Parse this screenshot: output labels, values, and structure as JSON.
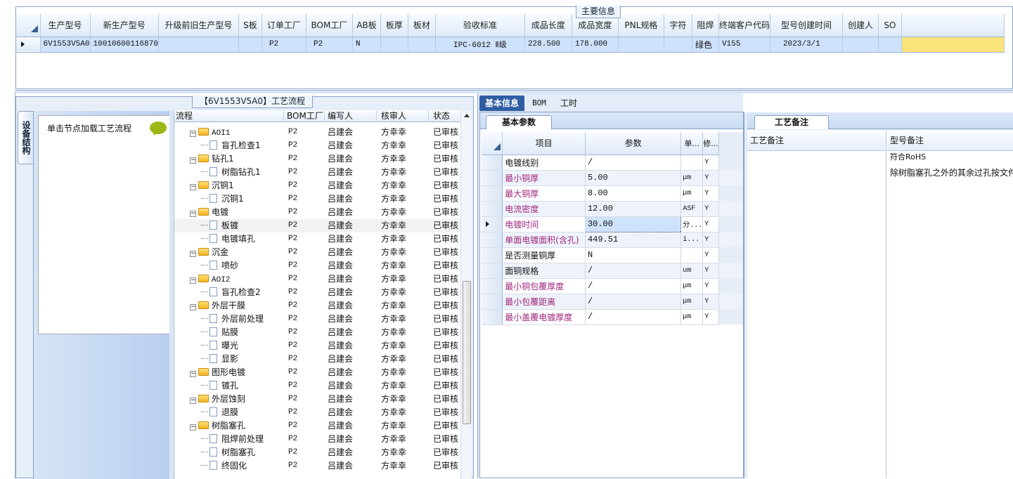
{
  "main": {
    "title": "主要信息",
    "columns": [
      "生产型号",
      "新生产型号",
      "升级前旧生产型号",
      "S板",
      "订单工厂",
      "BOM工厂",
      "AB板",
      "板厚",
      "板材",
      "验收标准",
      "成品长度",
      "成品宽度",
      "PNL规格",
      "字符",
      "阻焊",
      "终端客户代码",
      "型号创建时间",
      "创建人",
      "SO"
    ],
    "row": [
      "6V1553V5A0",
      "10010600116870",
      "",
      "",
      "P2",
      "P2",
      "N",
      "",
      "",
      "IPC-6012 Ⅱ级",
      "228.500",
      "178.000",
      "",
      "",
      "绿色",
      "V155",
      "2023/3/1",
      "",
      ""
    ]
  },
  "flow": {
    "title": "【6V1553V5A0】工艺流程",
    "vtab": "设备结构",
    "struct_hint": "单击节点加载工艺流程",
    "headers": [
      "流程",
      "BOM工厂",
      "编写人",
      "核审人",
      "状态"
    ],
    "rows": [
      {
        "name": "AOI1",
        "type": "folder",
        "bom": "P2",
        "writer": "吕建会",
        "reviewer": "方幸幸",
        "status": "已审核"
      },
      {
        "name": "盲孔检查1",
        "type": "doc",
        "bom": "P2",
        "writer": "吕建会",
        "reviewer": "方幸幸",
        "status": "已审核"
      },
      {
        "name": "钻孔1",
        "type": "folder",
        "bom": "P2",
        "writer": "吕建会",
        "reviewer": "方幸幸",
        "status": "已审核"
      },
      {
        "name": "树脂钻孔1",
        "type": "doc",
        "bom": "P2",
        "writer": "吕建会",
        "reviewer": "方幸幸",
        "status": "已审核"
      },
      {
        "name": "沉铜1",
        "type": "folder",
        "bom": "P2",
        "writer": "吕建会",
        "reviewer": "方幸幸",
        "status": "已审核"
      },
      {
        "name": "沉铜1",
        "type": "doc",
        "bom": "P2",
        "writer": "吕建会",
        "reviewer": "方幸幸",
        "status": "已审核"
      },
      {
        "name": "电镀",
        "type": "folder",
        "bom": "P2",
        "writer": "吕建会",
        "reviewer": "方幸幸",
        "status": "已审核"
      },
      {
        "name": "板镀",
        "type": "doc",
        "bom": "P2",
        "writer": "吕建会",
        "reviewer": "方幸幸",
        "status": "已审核",
        "selected": true
      },
      {
        "name": "电镀填孔",
        "type": "doc",
        "bom": "P2",
        "writer": "吕建会",
        "reviewer": "方幸幸",
        "status": "已审核"
      },
      {
        "name": "沉金",
        "type": "folder",
        "bom": "P2",
        "writer": "吕建会",
        "reviewer": "方幸幸",
        "status": "已审核"
      },
      {
        "name": "喷砂",
        "type": "doc",
        "bom": "P2",
        "writer": "吕建会",
        "reviewer": "方幸幸",
        "status": "已审核"
      },
      {
        "name": "AOI2",
        "type": "folder",
        "bom": "P2",
        "writer": "吕建会",
        "reviewer": "方幸幸",
        "status": "已审核"
      },
      {
        "name": "盲孔检查2",
        "type": "doc",
        "bom": "P2",
        "writer": "吕建会",
        "reviewer": "方幸幸",
        "status": "已审核"
      },
      {
        "name": "外层干膜",
        "type": "folder",
        "bom": "P2",
        "writer": "吕建会",
        "reviewer": "方幸幸",
        "status": "已审核"
      },
      {
        "name": "外层前处理",
        "type": "doc",
        "bom": "P2",
        "writer": "吕建会",
        "reviewer": "方幸幸",
        "status": "已审核"
      },
      {
        "name": "贴膜",
        "type": "doc",
        "bom": "P2",
        "writer": "吕建会",
        "reviewer": "方幸幸",
        "status": "已审核"
      },
      {
        "name": "曝光",
        "type": "doc",
        "bom": "P2",
        "writer": "吕建会",
        "reviewer": "方幸幸",
        "status": "已审核"
      },
      {
        "name": "显影",
        "type": "doc",
        "bom": "P2",
        "writer": "吕建会",
        "reviewer": "方幸幸",
        "status": "已审核"
      },
      {
        "name": "图形电镀",
        "type": "folder",
        "bom": "P2",
        "writer": "吕建会",
        "reviewer": "方幸幸",
        "status": "已审核"
      },
      {
        "name": "镀孔",
        "type": "doc",
        "bom": "P2",
        "writer": "吕建会",
        "reviewer": "方幸幸",
        "status": "已审核"
      },
      {
        "name": "外层蚀刻",
        "type": "folder",
        "bom": "P2",
        "writer": "吕建会",
        "reviewer": "方幸幸",
        "status": "已审核"
      },
      {
        "name": "退膜",
        "type": "doc",
        "bom": "P2",
        "writer": "吕建会",
        "reviewer": "方幸幸",
        "status": "已审核"
      },
      {
        "name": "树脂塞孔",
        "type": "folder",
        "bom": "P2",
        "writer": "吕建会",
        "reviewer": "方幸幸",
        "status": "已审核"
      },
      {
        "name": "阻焊前处理",
        "type": "doc",
        "bom": "P2",
        "writer": "吕建会",
        "reviewer": "方幸幸",
        "status": "已审核"
      },
      {
        "name": "树脂塞孔",
        "type": "doc",
        "bom": "P2",
        "writer": "吕建会",
        "reviewer": "方幸幸",
        "status": "已审核"
      },
      {
        "name": "终固化",
        "type": "doc",
        "bom": "P2",
        "writer": "吕建会",
        "reviewer": "方幸幸",
        "status": "已审核"
      }
    ]
  },
  "info": {
    "tabs": [
      "基本信息",
      "BOM",
      "工时"
    ],
    "params_tab": "基本参数",
    "headers": [
      "项目",
      "参数",
      "单...",
      "修..."
    ],
    "rows": [
      {
        "item": "电镀线别",
        "value": "/",
        "unit": "",
        "mod": "Y",
        "pink": false
      },
      {
        "item": "最小铜厚",
        "value": "5.00",
        "unit": "μm",
        "mod": "Y",
        "pink": true
      },
      {
        "item": "最大铜厚",
        "value": "8.00",
        "unit": "μm",
        "mod": "Y",
        "pink": true
      },
      {
        "item": "电流密度",
        "value": "12.00",
        "unit": "ASF",
        "mod": "Y",
        "pink": true
      },
      {
        "item": "电镀时间",
        "value": "30.00",
        "unit": "分...",
        "mod": "Y",
        "pink": true,
        "current": true
      },
      {
        "item": "单面电镀面积(含孔)",
        "value": "449.51",
        "unit": "i...",
        "mod": "Y",
        "pink": true
      },
      {
        "item": "是否测量铜厚",
        "value": "N",
        "unit": "",
        "mod": "Y",
        "pink": false
      },
      {
        "item": "面铜规格",
        "value": "/",
        "unit": "um",
        "mod": "Y",
        "pink": false
      },
      {
        "item": "最小铜包覆厚度",
        "value": "/",
        "unit": "μm",
        "mod": "Y",
        "pink": true
      },
      {
        "item": "最小包覆距离",
        "value": "/",
        "unit": "μm",
        "mod": "Y",
        "pink": true
      },
      {
        "item": "最小盖覆电镀厚度",
        "value": "/",
        "unit": "μm",
        "mod": "Y",
        "pink": true
      }
    ]
  },
  "remarks": {
    "tab": "工艺备注",
    "col1": "工艺备注",
    "col2": "型号备注",
    "notes": [
      "符合RoHS",
      "除树脂塞孔之外的其余过孔按文件"
    ]
  },
  "colors": {
    "accent": "#2f5da3",
    "selection": "#cfe2fb",
    "pink": "#a0257c",
    "highlight": "#fbe47a"
  }
}
